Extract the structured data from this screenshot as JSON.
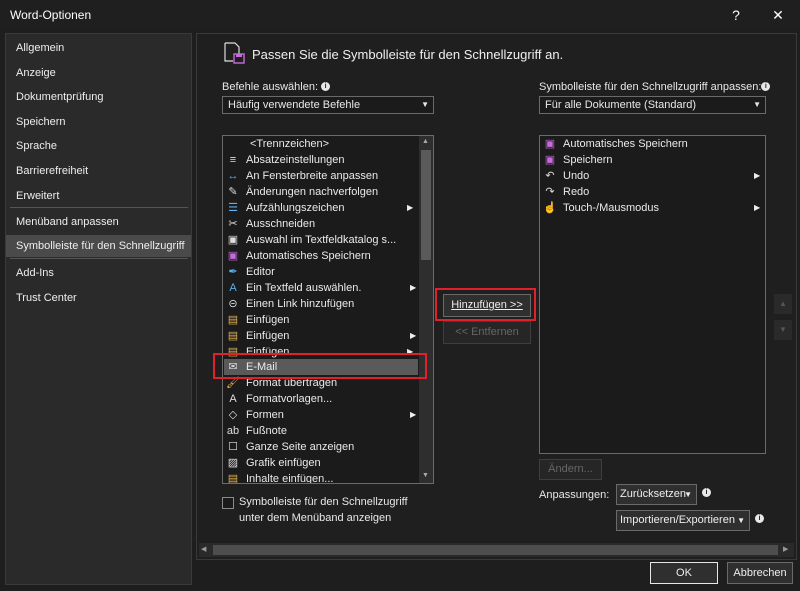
{
  "window": {
    "title": "Word-Optionen",
    "help": "?",
    "close": "✕"
  },
  "sidebar": {
    "items": [
      {
        "label": "Allgemein"
      },
      {
        "label": "Anzeige"
      },
      {
        "label": "Dokumentprüfung"
      },
      {
        "label": "Speichern"
      },
      {
        "label": "Sprache"
      },
      {
        "label": "Barrierefreiheit"
      },
      {
        "label": "Erweitert"
      },
      {
        "label": "Menüband anpassen"
      },
      {
        "label": "Symbolleiste für den Schnellzugriff"
      },
      {
        "label": "Add-Ins"
      },
      {
        "label": "Trust Center"
      }
    ],
    "active_index": 8
  },
  "main": {
    "heading": "Passen Sie die Symbolleiste für den Schnellzugriff an.",
    "choose_label": "Befehle auswählen:",
    "choose_value": "Häufig verwendete Befehle",
    "customize_label": "Symbolleiste für den Schnellzugriff anpassen:",
    "customize_value": "Für alle Dokumente (Standard)",
    "commands": [
      {
        "label": "<Trennzeichen>",
        "icon": "separator"
      },
      {
        "label": "Absatzeinstellungen",
        "icon": "paragraph-icon"
      },
      {
        "label": "An Fensterbreite anpassen",
        "icon": "fit-width-icon"
      },
      {
        "label": "Änderungen nachverfolgen",
        "icon": "track-changes-icon"
      },
      {
        "label": "Aufzählungszeichen",
        "icon": "bullets-icon",
        "submenu": true
      },
      {
        "label": "Ausschneiden",
        "icon": "scissors-icon"
      },
      {
        "label": "Auswahl im Textfeldkatalog s...",
        "icon": "textbox-gallery-icon"
      },
      {
        "label": "Automatisches Speichern",
        "icon": "autosave-icon"
      },
      {
        "label": "Editor",
        "icon": "editor-icon"
      },
      {
        "label": "Ein Textfeld auswählen.",
        "icon": "textbox-icon",
        "submenu": true
      },
      {
        "label": "Einen Link hinzufügen",
        "icon": "link-icon"
      },
      {
        "label": "Einfügen",
        "icon": "paste-icon"
      },
      {
        "label": "Einfügen",
        "icon": "paste-icon",
        "submenu": true
      },
      {
        "label": "Einfügen",
        "icon": "paste-icon",
        "submenu": true
      },
      {
        "label": "E-Mail",
        "icon": "email-icon",
        "selected": true
      },
      {
        "label": "Format übertragen",
        "icon": "format-painter-icon"
      },
      {
        "label": "Formatvorlagen...",
        "icon": "styles-icon"
      },
      {
        "label": "Formen",
        "icon": "shapes-icon",
        "submenu": true
      },
      {
        "label": "Fußnote",
        "icon": "footnote-icon"
      },
      {
        "label": "Ganze Seite anzeigen",
        "icon": "full-page-icon"
      },
      {
        "label": "Grafik einfügen",
        "icon": "picture-icon"
      },
      {
        "label": "Inhalte einfügen...",
        "icon": "paste-special-icon"
      }
    ],
    "qat": [
      {
        "label": "Automatisches Speichern",
        "icon": "autosave-icon"
      },
      {
        "label": "Speichern",
        "icon": "save-icon"
      },
      {
        "label": "Undo",
        "icon": "undo-icon",
        "submenu": true
      },
      {
        "label": "Redo",
        "icon": "redo-icon"
      },
      {
        "label": "Touch-/Mausmodus",
        "icon": "touch-icon",
        "submenu": true
      }
    ],
    "add_button": "Hinzufügen >>",
    "remove_button": "<< Entfernen",
    "modify_button": "Ändern...",
    "show_below_line1": "Symbolleiste für den Schnellzugriff",
    "show_below_line2": "unter dem Menüband anzeigen",
    "customizations_label": "Anpassungen:",
    "reset_button": "Zurücksetzen",
    "import_export_button": "Importieren/Exportieren"
  },
  "footer": {
    "ok": "OK",
    "cancel": "Abbrechen"
  },
  "colors": {
    "highlight": "#e0202a",
    "autosave": "#c66bd9"
  }
}
